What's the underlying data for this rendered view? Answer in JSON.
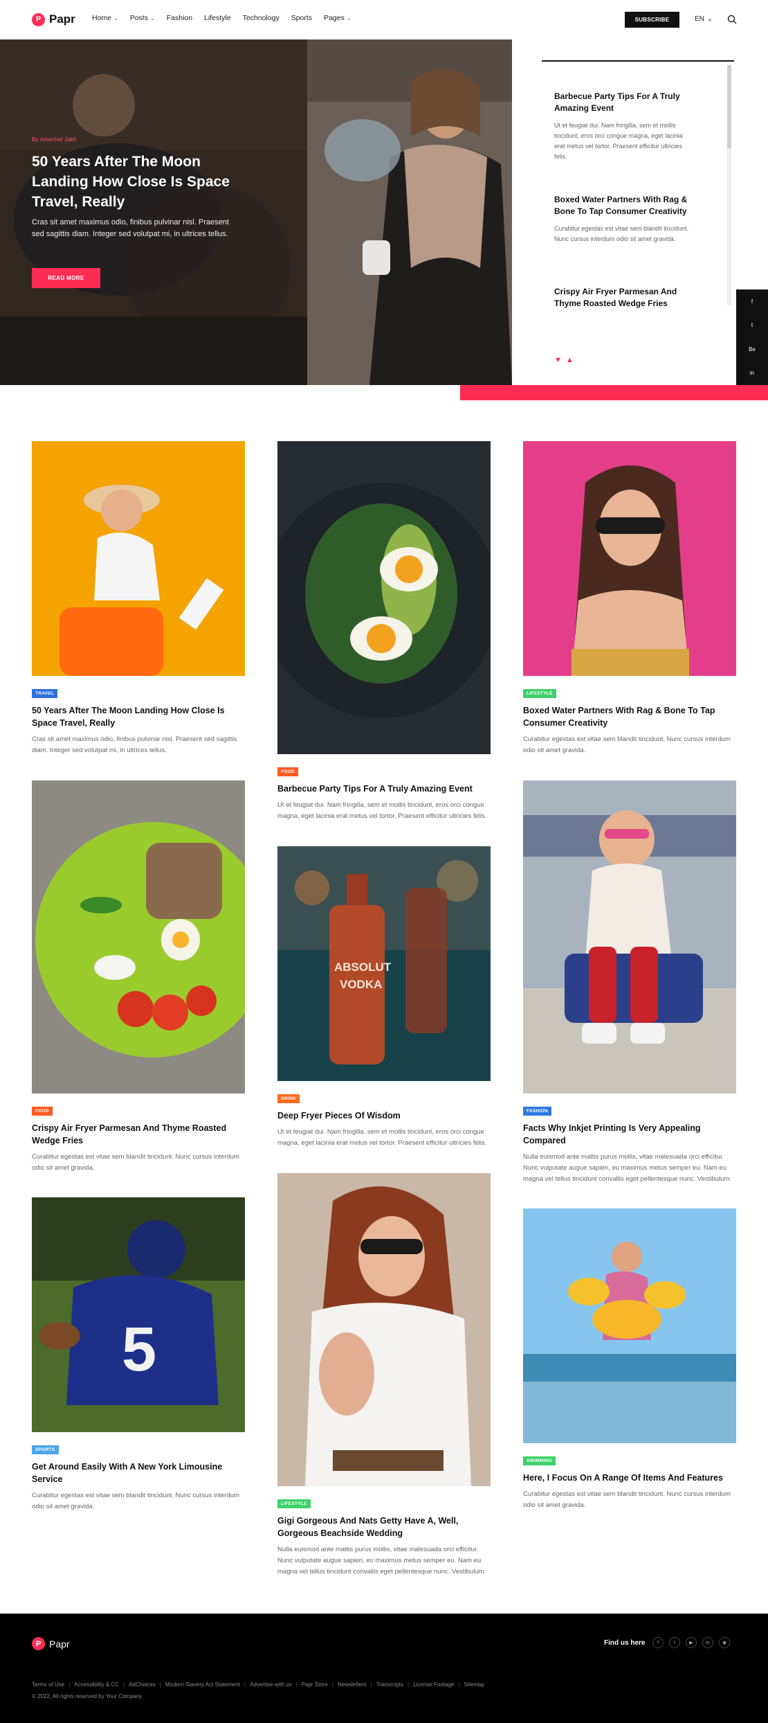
{
  "header": {
    "logo": "Papr",
    "logo_mark": "P",
    "nav": [
      {
        "label": "Home",
        "dropdown": true
      },
      {
        "label": "Posts",
        "dropdown": true
      },
      {
        "label": "Fashion",
        "dropdown": false
      },
      {
        "label": "Lifestyle",
        "dropdown": false
      },
      {
        "label": "Technology",
        "dropdown": false
      },
      {
        "label": "Sports",
        "dropdown": false
      },
      {
        "label": "Pages",
        "dropdown": true
      }
    ],
    "subscribe": "SUBSCRIBE",
    "lang": "EN",
    "lang_chevron": "⌄"
  },
  "hero": {
    "author": "By Amschel Jakh",
    "title": "50 Years After The Moon Landing How Close Is Space Travel, Really",
    "excerpt": "Cras sit amet maximus odio, finibus pulvinar nisl. Praesent sed sagittis diam. Integer sed volutpat mi, in ultrices tellus.",
    "button": "READ MORE"
  },
  "side_posts": [
    {
      "title": "Barbecue Party Tips For A Truly Amazing Event",
      "excerpt": "Ut et feugiat dui. Nam fringilla, sem et mollis tincidunt, eros orci congue magna, eget lacinia erat metus vel tortor. Praesent efficitur ultricies felis."
    },
    {
      "title": "Boxed Water Partners With Rag & Bone To Tap Consumer Creativity",
      "excerpt": "Curabitur egestas est vitae sem blandit tincidunt. Nunc cursus interdum odio sit amet gravida."
    },
    {
      "title": "Crispy Air Fryer Parmesan And Thyme Roasted Wedge Fries",
      "excerpt": ""
    }
  ],
  "side_arrows": {
    "down": "▼",
    "up": "▲"
  },
  "social_rail": [
    "f",
    "t",
    "Be",
    "in"
  ],
  "colors": {
    "accent": "#ff2d55",
    "travel": "#2f6fe0",
    "food": "#ff5a1f",
    "lifestyle": "#3fd16b",
    "fashion": "#2f7ae0",
    "sports": "#4aa6e8",
    "drink": "#ff6a1f",
    "swimming": "#3fd16b"
  },
  "cards": {
    "c1": {
      "cat": "TRAVEL",
      "title": "50 Years After The Moon Landing How Close Is Space Travel, Really",
      "excerpt": "Cras sit amet maximus odio, finibus pulvinar nisl. Praesent sed sagittis diam. Integer sed volutpat mi, in ultrices tellus."
    },
    "c2": {
      "cat": "FOOD",
      "title": "Barbecue Party Tips For A Truly Amazing Event",
      "excerpt": "Ut et feugiat dui. Nam fringilla, sem et mollis tincidunt, eros orci congue magna, eget lacinia erat metus vel tortor. Praesent efficitur ultricies felis."
    },
    "c3": {
      "cat": "LIFESTYLE",
      "title": "Boxed Water Partners With Rag & Bone To Tap Consumer Creativity",
      "excerpt": "Curabitur egestas est vitae sem blandit tincidunt. Nunc cursus interdum odio sit amet gravida."
    },
    "c4": {
      "cat": "FOOD",
      "title": "Crispy Air Fryer Parmesan And Thyme Roasted Wedge Fries",
      "excerpt": "Curabitur egestas est vitae sem blandit tincidunt. Nunc cursus interdum odio sit amet gravida."
    },
    "c5": {
      "cat": "DRINK",
      "title": "Deep Fryer Pieces Of Wisdom",
      "excerpt": "Ut et feugiat dui. Nam fringilla, sem et mollis tincidunt, eros orci congue magna, eget lacinia erat metus vel tortor. Praesent efficitur ultricies felis."
    },
    "c6": {
      "cat": "FASHION",
      "title": "Facts Why Inkjet Printing Is Very Appealing Compared",
      "excerpt": "Nulla euismod ante mattis purus mollis, vitae malesuada orci efficitur. Nunc vulputate augue sapien, eu maximus metus semper eu. Nam eu magna vel tellus tincidunt convallis eget pellentesque nunc. Vestibulum."
    },
    "c7": {
      "cat": "SPORTS",
      "title": "Get Around Easily With A New York Limousine Service",
      "excerpt": "Curabitur egestas est vitae sem blandit tincidunt. Nunc cursus interdum odio sit amet gravida."
    },
    "c8": {
      "cat": "LIFESTYLE",
      "title": "Gigi Gorgeous And Nats Getty Have A, Well, Gorgeous Beachside Wedding",
      "excerpt": "Nulla euismod ante mattis purus mollis, vitae malesuada orci efficitur. Nunc vulputate augue sapien, eu maximus metus semper eu. Nam eu magna vel tellus tincidunt convallis eget pellentesque nunc. Vestibulum."
    },
    "c9": {
      "cat": "SWIMMING",
      "title": "Here, I Focus On A Range Of Items And Features",
      "excerpt": "Curabitur egestas est vitae sem blandit tincidunt. Nunc cursus interdum odio sit amet gravida."
    }
  },
  "footer": {
    "logo": "Papr",
    "logo_mark": "P",
    "find_us": "Find us here",
    "social": [
      "f",
      "t",
      "▶",
      "in",
      "◉"
    ],
    "links": [
      "Terms of Use",
      "Accessibility & CC",
      "AdChoices",
      "Modern Slavery Act Statement",
      "Advertise with us",
      "Papr Store",
      "Newsletters",
      "Transcripts",
      "License Footage",
      "Sitemap"
    ],
    "copyright": "© 2022, All rights reserved by Your Company"
  }
}
